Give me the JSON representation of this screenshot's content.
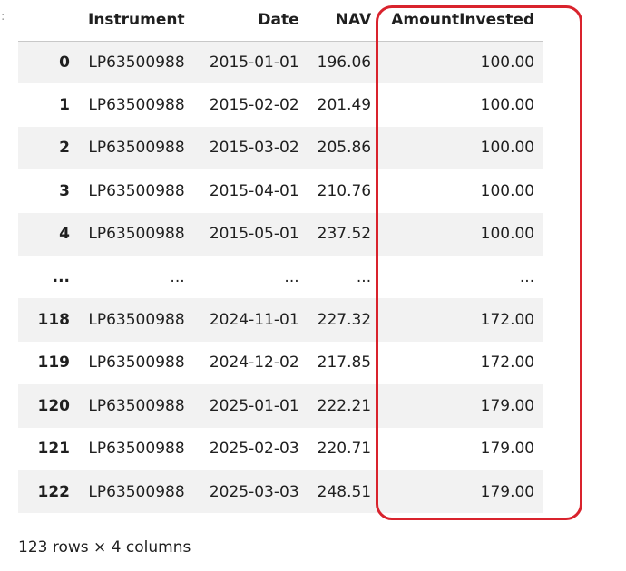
{
  "prompt_marker": ":",
  "table": {
    "columns": [
      "",
      "Instrument",
      "Date",
      "NAV",
      "AmountInvested"
    ],
    "rows": [
      {
        "index": "0",
        "instrument": "LP63500988",
        "date": "2015-01-01",
        "nav": "196.06",
        "amount": "100.00"
      },
      {
        "index": "1",
        "instrument": "LP63500988",
        "date": "2015-02-02",
        "nav": "201.49",
        "amount": "100.00"
      },
      {
        "index": "2",
        "instrument": "LP63500988",
        "date": "2015-03-02",
        "nav": "205.86",
        "amount": "100.00"
      },
      {
        "index": "3",
        "instrument": "LP63500988",
        "date": "2015-04-01",
        "nav": "210.76",
        "amount": "100.00"
      },
      {
        "index": "4",
        "instrument": "LP63500988",
        "date": "2015-05-01",
        "nav": "237.52",
        "amount": "100.00"
      },
      {
        "index": "...",
        "instrument": "...",
        "date": "...",
        "nav": "...",
        "amount": "..."
      },
      {
        "index": "118",
        "instrument": "LP63500988",
        "date": "2024-11-01",
        "nav": "227.32",
        "amount": "172.00"
      },
      {
        "index": "119",
        "instrument": "LP63500988",
        "date": "2024-12-02",
        "nav": "217.85",
        "amount": "172.00"
      },
      {
        "index": "120",
        "instrument": "LP63500988",
        "date": "2025-01-01",
        "nav": "222.21",
        "amount": "179.00"
      },
      {
        "index": "121",
        "instrument": "LP63500988",
        "date": "2025-02-03",
        "nav": "220.71",
        "amount": "179.00"
      },
      {
        "index": "122",
        "instrument": "LP63500988",
        "date": "2025-03-03",
        "nav": "248.51",
        "amount": "179.00"
      }
    ]
  },
  "highlight": {
    "column": "AmountInvested",
    "color": "#d9232d"
  },
  "footer": "123 rows × 4 columns"
}
